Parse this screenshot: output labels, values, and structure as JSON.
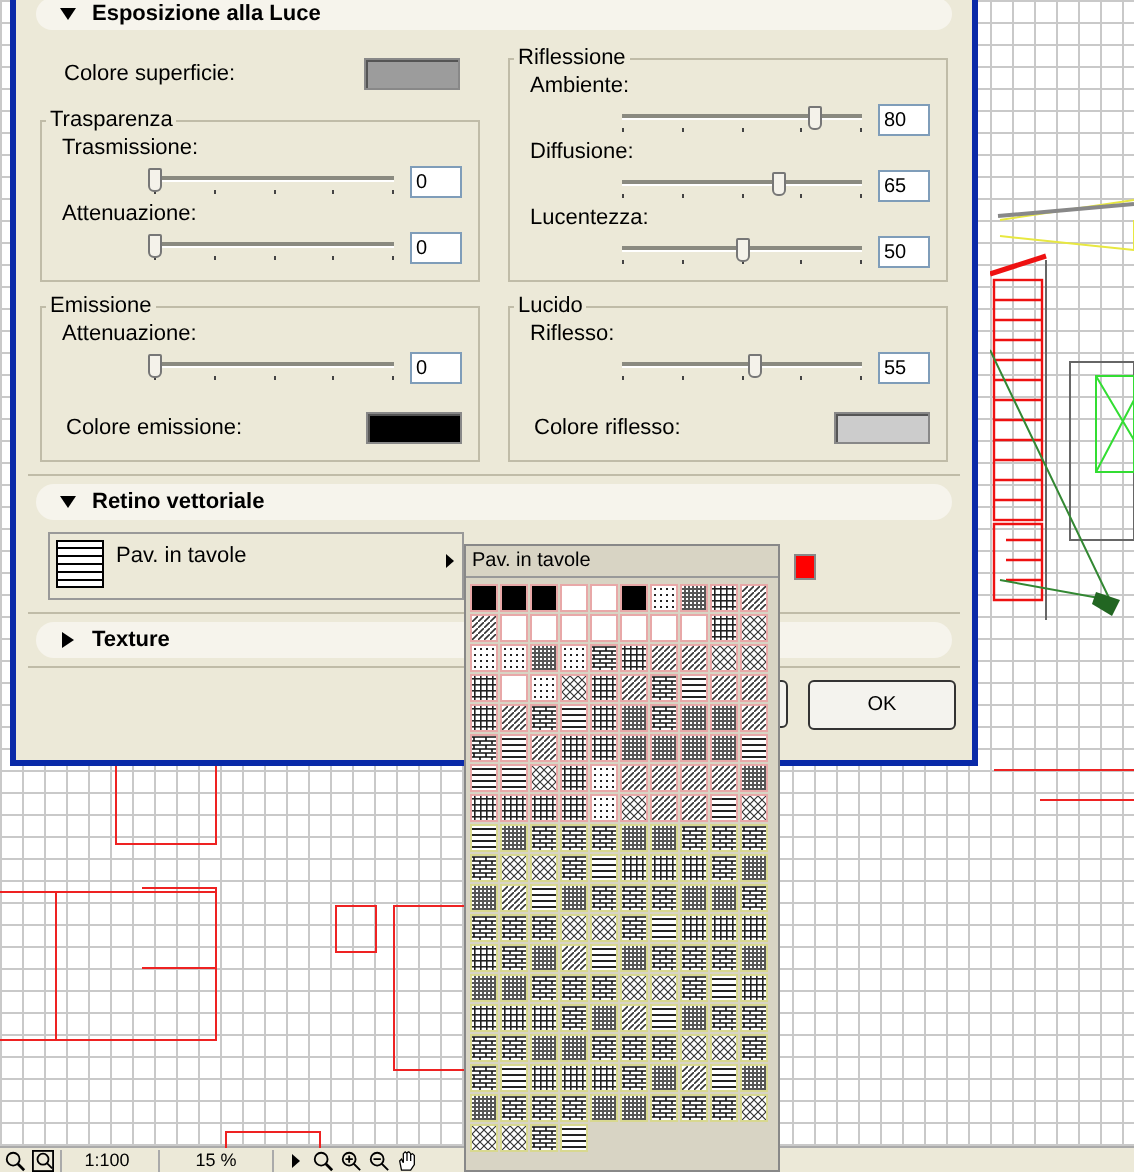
{
  "light_section": {
    "title": "Esposizione alla Luce",
    "expanded": true,
    "columns": [
      {
        "surface_color": {
          "label": "Colore superficie:",
          "color": "#9c9c9c"
        },
        "groups": [
          {
            "title": "Trasparenza",
            "sliders": [
              {
                "label": "Trasmissione:",
                "level": 0,
                "value": "0"
              },
              {
                "label": "Attenuazione:",
                "level": 0,
                "value": "0"
              }
            ]
          },
          {
            "title": "Emissione",
            "sliders": [
              {
                "label": "Attenuazione:",
                "level": 0,
                "value": "0"
              }
            ],
            "swatch": {
              "label": "Colore emissione:",
              "color": "#000000"
            }
          }
        ]
      },
      {
        "groups": [
          {
            "title": "Riflessione",
            "sliders": [
              {
                "label": "Ambiente:",
                "level": 0.8,
                "value": "80"
              },
              {
                "label": "Diffusione:",
                "level": 0.65,
                "value": "65"
              },
              {
                "label": "Lucentezza:",
                "level": 0.5,
                "value": "50"
              }
            ]
          },
          {
            "title": "Lucido",
            "sliders": [
              {
                "label": "Riflesso:",
                "level": 0.55,
                "value": "55"
              }
            ],
            "swatch": {
              "label": "Colore riflesso:",
              "color": "#cccccc"
            }
          }
        ]
      }
    ]
  },
  "vector_hatch_section": {
    "title": "Retino vettoriale",
    "expanded": true,
    "fill": {
      "label": "Pav. in tavole"
    },
    "pen": {
      "color": "#ff0000"
    }
  },
  "texture_section": {
    "title": "Texture",
    "expanded": false
  },
  "buttons": [
    {
      "label": "OK"
    }
  ],
  "palette": {
    "title": "Pav. in tavole"
  },
  "status_bar": {
    "scale": "1:100",
    "zoom": "15 %"
  }
}
